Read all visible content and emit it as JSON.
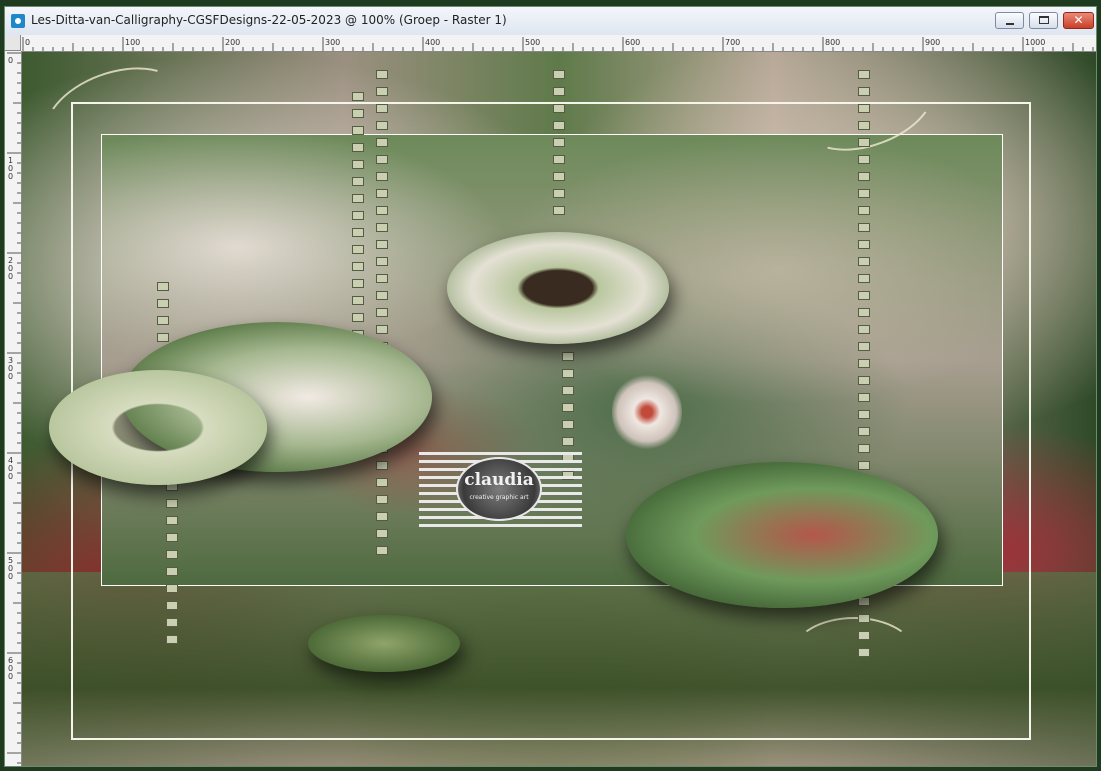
{
  "window": {
    "title": "Les-Ditta-van-Calligraphy-CGSFDesigns-22-05-2023 @ 100% (Groep - Raster 1)",
    "minimize_label": "–",
    "close_label": "✕"
  },
  "ruler_top": {
    "ticks": [
      "0",
      "100",
      "200",
      "300",
      "400",
      "500",
      "600",
      "700",
      "800",
      "900",
      "1000"
    ]
  },
  "ruler_left": {
    "ticks": [
      "0",
      "1\n0\n0",
      "2\n0\n0",
      "3\n0\n0",
      "4\n0\n0",
      "5\n0\n0",
      "6\n0\n0"
    ]
  },
  "canvas": {
    "logo_text": "claudia",
    "logo_subtext": "creative graphic art"
  },
  "colors": {
    "titlebar": "#e8edf5",
    "close_button": "#c9402a",
    "window_border": "#1f3b1f"
  }
}
